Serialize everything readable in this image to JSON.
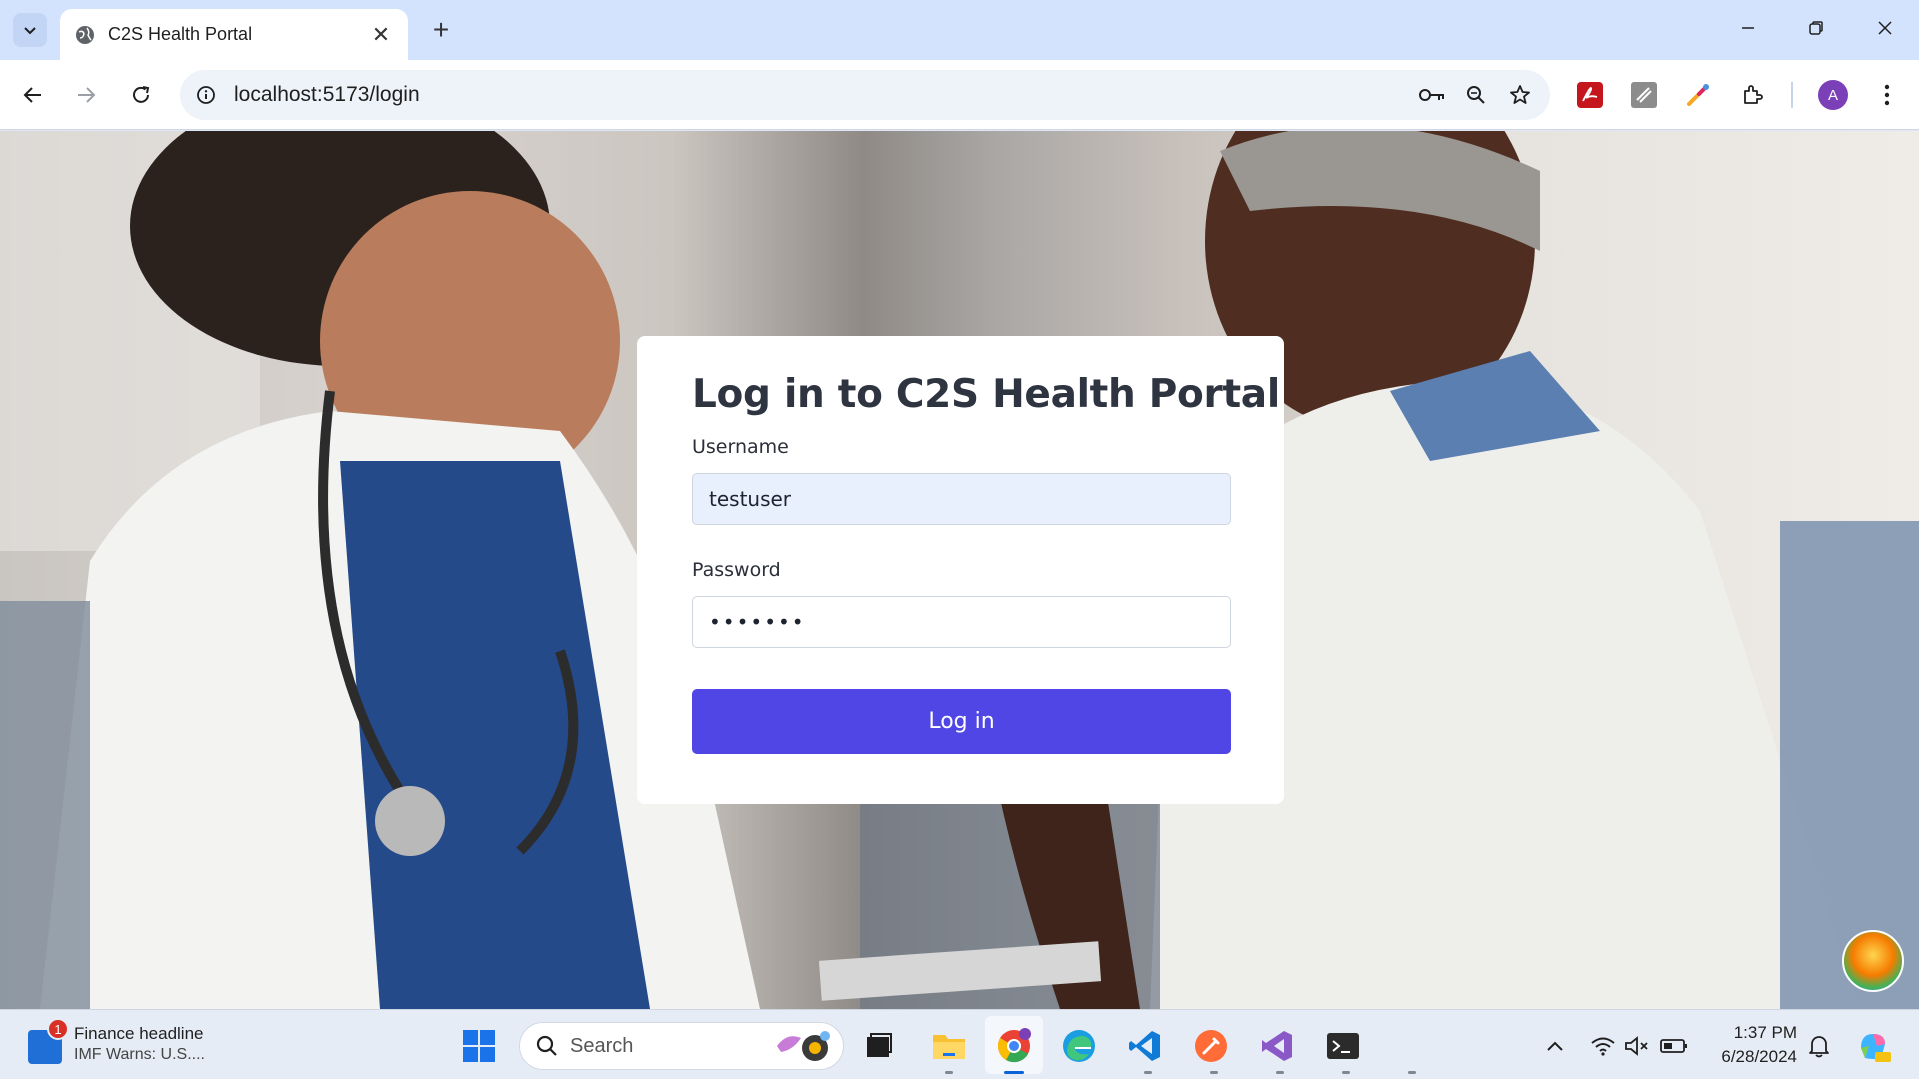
{
  "browser": {
    "tab_title": "C2S Health Portal",
    "tab_close": "✕",
    "new_tab": "+",
    "url": "localhost:5173/login",
    "profile_initial": "A"
  },
  "login": {
    "title": "Log in to C2S Health Portal",
    "username_label": "Username",
    "username_value": "testuser",
    "password_label": "Password",
    "password_value": "•••••••",
    "submit_label": "Log in"
  },
  "taskbar": {
    "widget_badge": "1",
    "widget_title": "Finance headline",
    "widget_subtitle": "IMF Warns: U.S....",
    "search_placeholder": "Search",
    "time": "1:37 PM",
    "date": "6/28/2024"
  },
  "colors": {
    "primary_button": "#4f46e5",
    "tabstrip": "#d3e3fd",
    "username_autofill_bg": "#e8f0fe"
  }
}
